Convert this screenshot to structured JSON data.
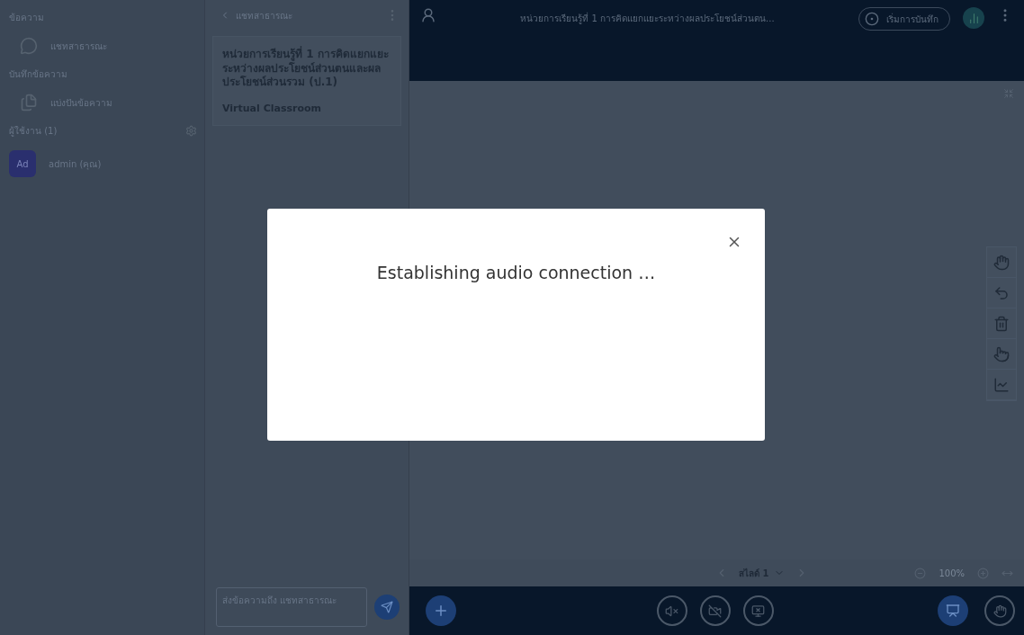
{
  "sidebar": {
    "messages_heading": "ข้อความ",
    "chat_item": "แชทสาธารณะ",
    "notes_heading": "บันทึกข้อความ",
    "notes_item": "แบ่งปันข้อความ",
    "users_heading": "ผู้ใช้งาน (1)",
    "users": [
      {
        "initials": "Ad",
        "name": "admin (คุณ)"
      }
    ]
  },
  "chat": {
    "title": "แชทสาธารณะ",
    "welcome": "หน่วยการเรียนรู้ที่ 1 การคิดแยกแยะระหว่างผลประโยชน์ส่วนตนและผลประโยชน์ส่วนรวม (ป.1)",
    "welcome_sub": "Virtual Classroom",
    "input": {
      "placeholder": "ส่งข้อความถึง แชทสาธารณะ"
    }
  },
  "top_bar": {
    "title": "หน่วยการเรียนรู้ที่ 1 การคิดแยกแยะระหว่างผลประโยชน์ส่วนตน...",
    "record_button": "เริ่มการบันทึก"
  },
  "tools": [
    {
      "kind": "hand",
      "selected": false
    },
    {
      "kind": "undo",
      "selected": false
    },
    {
      "kind": "trash",
      "selected": false
    },
    {
      "kind": "pointer",
      "selected": false
    },
    {
      "kind": "chart",
      "selected": false
    }
  ],
  "slide_nav": {
    "slide": "สไลด์ 1",
    "zoom": "100%"
  },
  "dialog": {
    "message": "Establishing audio connection …"
  }
}
